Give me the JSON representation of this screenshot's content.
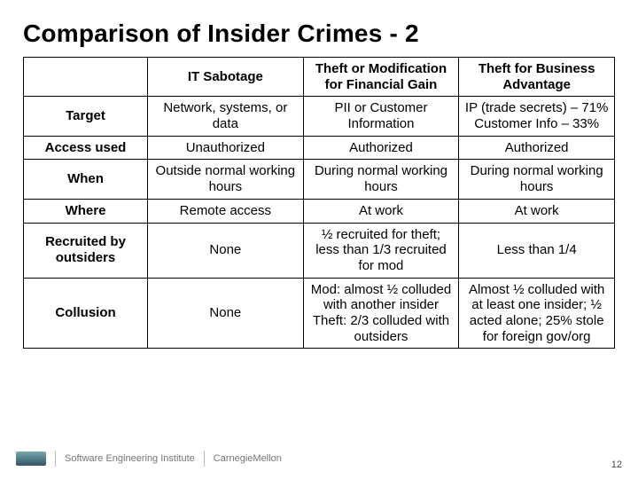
{
  "slide": {
    "title": "Comparison of Insider Crimes - 2",
    "page_number": "12"
  },
  "table": {
    "columns": [
      "IT Sabotage",
      "Theft or Modification for Financial Gain",
      "Theft for Business Advantage"
    ],
    "rows": [
      {
        "label": "Target",
        "cells": [
          "Network, systems, or data",
          "PII or Customer Information",
          "IP (trade secrets) – 71%\nCustomer Info – 33%"
        ]
      },
      {
        "label": "Access used",
        "cells": [
          "Unauthorized",
          "Authorized",
          "Authorized"
        ]
      },
      {
        "label": "When",
        "cells": [
          "Outside normal working hours",
          "During normal working hours",
          "During normal working hours"
        ]
      },
      {
        "label": "Where",
        "cells": [
          "Remote access",
          "At work",
          "At work"
        ]
      },
      {
        "label": "Recruited by outsiders",
        "cells": [
          "None",
          "½ recruited for theft; less than 1/3 recruited for mod",
          "Less than 1/4"
        ]
      },
      {
        "label": "Collusion",
        "cells": [
          "None",
          "Mod: almost ½ colluded with another insider\nTheft: 2/3 colluded with outsiders",
          "Almost ½ colluded with at least one insider; ½ acted alone; 25% stole for foreign gov/org"
        ]
      }
    ]
  },
  "footer": {
    "org1": "Software Engineering Institute",
    "org2": "CarnegieMellon"
  }
}
